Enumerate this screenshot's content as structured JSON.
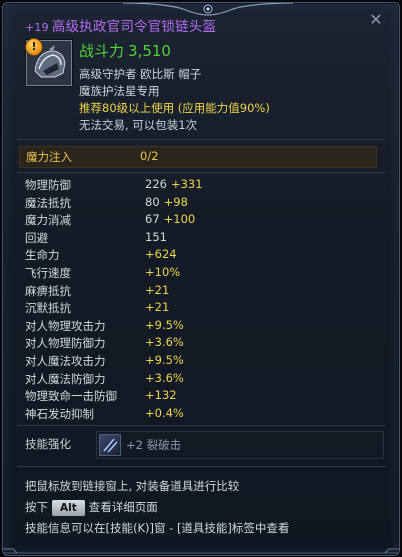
{
  "tooltip": {
    "title": {
      "enchant": "+19",
      "name": "高级执政官司令官锁链头盔"
    },
    "combat_label": "战斗力",
    "combat_value": "3,510",
    "info": [
      {
        "text": "高级守护者 欧比斯 帽子",
        "style": "norm"
      },
      {
        "text": "魔族护法星专用",
        "style": "norm"
      },
      {
        "text": "推荐80级以上使用 (应用能力值90%)",
        "style": "hl"
      },
      {
        "text": "无法交易, 可以包装1次",
        "style": "norm"
      }
    ],
    "mana": {
      "label": "魔力注入",
      "value": "0/2"
    },
    "stats": [
      {
        "name": "物理防御",
        "base": "226",
        "bonus": "+331"
      },
      {
        "name": "魔法抵抗",
        "base": "80",
        "bonus": "+98"
      },
      {
        "name": "魔力消减",
        "base": "67",
        "bonus": "+100"
      },
      {
        "name": "回避",
        "base": "151",
        "bonus": ""
      },
      {
        "name": "生命力",
        "base": "",
        "bonus": "+624"
      },
      {
        "name": "飞行速度",
        "base": "",
        "bonus": "+10%"
      },
      {
        "name": "麻痹抵抗",
        "base": "",
        "bonus": "+21"
      },
      {
        "name": "沉默抵抗",
        "base": "",
        "bonus": "+21"
      },
      {
        "name": "对人物理攻击力",
        "base": "",
        "bonus": "+9.5%"
      },
      {
        "name": "对人物理防御力",
        "base": "",
        "bonus": "+3.6%"
      },
      {
        "name": "对人魔法攻击力",
        "base": "",
        "bonus": "+9.5%"
      },
      {
        "name": "对人魔法防御力",
        "base": "",
        "bonus": "+3.6%"
      },
      {
        "name": "物理致命一击防御",
        "base": "",
        "bonus": "+132"
      },
      {
        "name": "神石发动抑制",
        "base": "",
        "bonus": "+0.4%"
      }
    ],
    "skill": {
      "label": "技能强化",
      "text": "+2 裂破击"
    },
    "footer": {
      "line1": "把鼠标放到链接窗上, 对装备道具进行比较",
      "line2_pre": "按下",
      "key": "Alt",
      "line2_post": "查看详细页面",
      "line3": "技能信息可以在[技能(K)]窗 - [道具技能]标签中查看"
    },
    "close_symbol": "✕",
    "warn_symbol": "!"
  }
}
